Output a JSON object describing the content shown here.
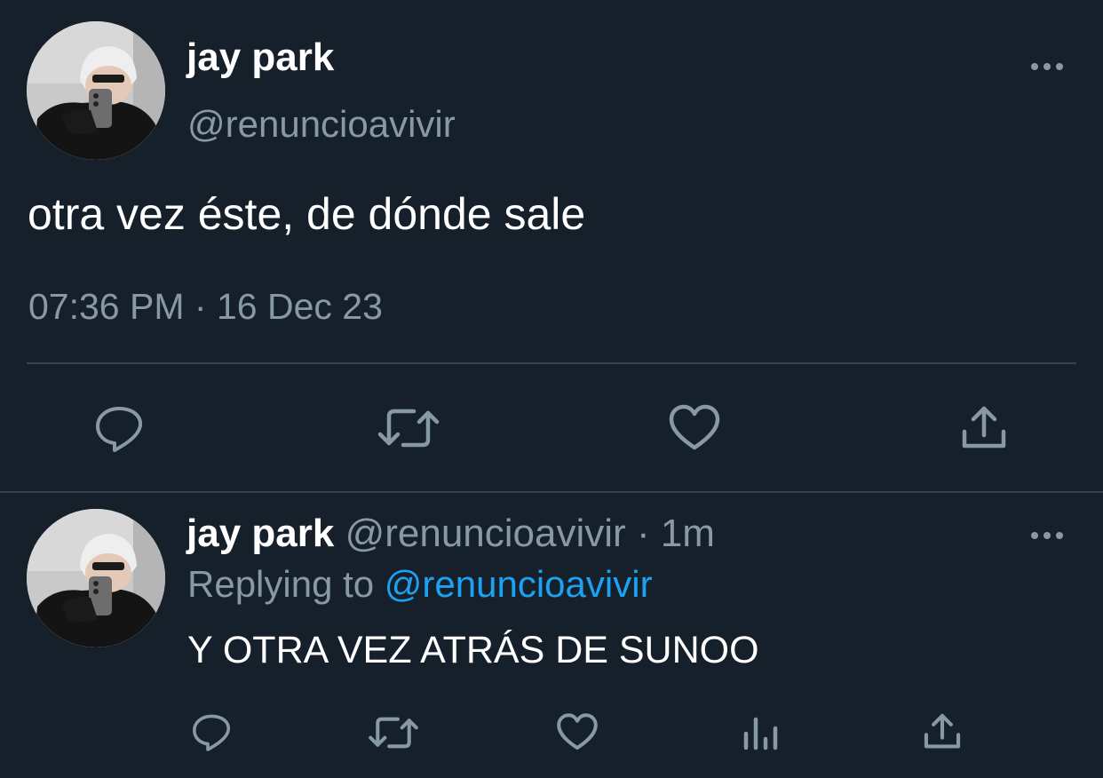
{
  "main_tweet": {
    "display_name": "jay park",
    "handle": "@renuncioavivir",
    "text": "otra vez éste, de dónde sale",
    "time": "07:36 PM",
    "separator": "·",
    "date": "16 Dec 23",
    "actions": [
      "reply-icon",
      "retweet-icon",
      "like-icon",
      "share-icon"
    ]
  },
  "reply_tweet": {
    "display_name": "jay park",
    "handle": "@renuncioavivir",
    "separator": "·",
    "age": "1m",
    "replying_prefix": "Replying to",
    "replying_to": "@renuncioavivir",
    "text": "Y OTRA VEZ ATRÁS DE SUNOO",
    "actions": [
      "reply-icon",
      "retweet-icon",
      "like-icon",
      "analytics-icon",
      "share-icon"
    ]
  },
  "colors": {
    "background": "#15202b",
    "text": "#ffffff",
    "muted": "#8899a6",
    "link": "#1da1f2",
    "divider": "#38444d"
  }
}
